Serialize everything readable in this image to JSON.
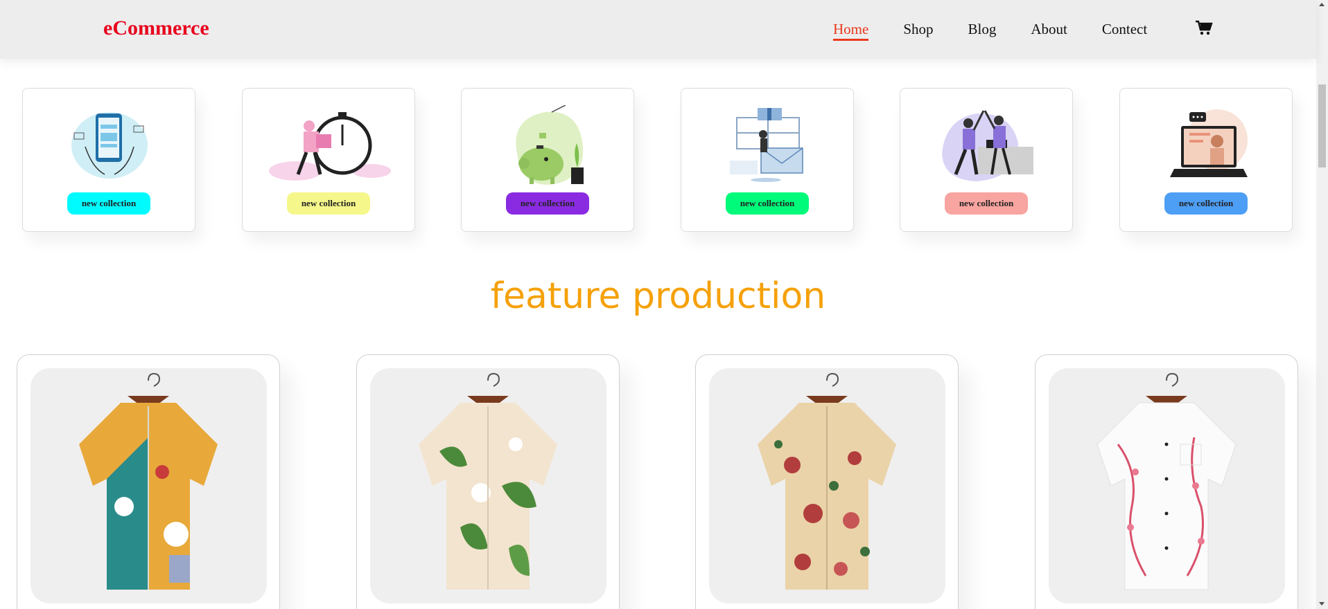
{
  "header": {
    "logo": "eCommerce",
    "nav": [
      "Home",
      "Shop",
      "Blog",
      "About",
      "Contect"
    ],
    "active": "Home",
    "cart_icon": "cart-icon"
  },
  "collections": [
    {
      "label": "new collection",
      "pill_color": "#00fbff",
      "illustration": "mobile-payment-illustration"
    },
    {
      "label": "new collection",
      "pill_color": "#f6f78a",
      "illustration": "delivery-timer-illustration"
    },
    {
      "label": "new collection",
      "pill_color": "#8a2be2",
      "illustration": "piggy-bank-illustration"
    },
    {
      "label": "new collection",
      "pill_color": "#00fa7a",
      "illustration": "gift-envelope-illustration"
    },
    {
      "label": "new collection",
      "pill_color": "#f8a4a0",
      "illustration": "high-five-illustration"
    },
    {
      "label": "new collection",
      "pill_color": "#4d9ef5",
      "illustration": "video-call-illustration"
    }
  ],
  "section": {
    "title": "feature production"
  },
  "products": [
    {
      "image": "floral-shirt-multicolor",
      "colors": [
        "#e8a93a",
        "#2a8c8a",
        "#ffffff"
      ]
    },
    {
      "image": "floral-shirt-green-lily",
      "colors": [
        "#f3e4cf",
        "#4b8a3a",
        "#ffffff"
      ]
    },
    {
      "image": "floral-shirt-red-roses",
      "colors": [
        "#ead3a8",
        "#b23d3d",
        "#3c6f3c"
      ]
    },
    {
      "image": "floral-shirt-pink-blossom",
      "colors": [
        "#fbfbfb",
        "#d9506a",
        "#a0a0a0"
      ]
    }
  ],
  "colors": {
    "logo": "#e8001c",
    "nav_active": "#e8391c",
    "section_title": "#f5a10a",
    "header_bg": "#ededed"
  }
}
